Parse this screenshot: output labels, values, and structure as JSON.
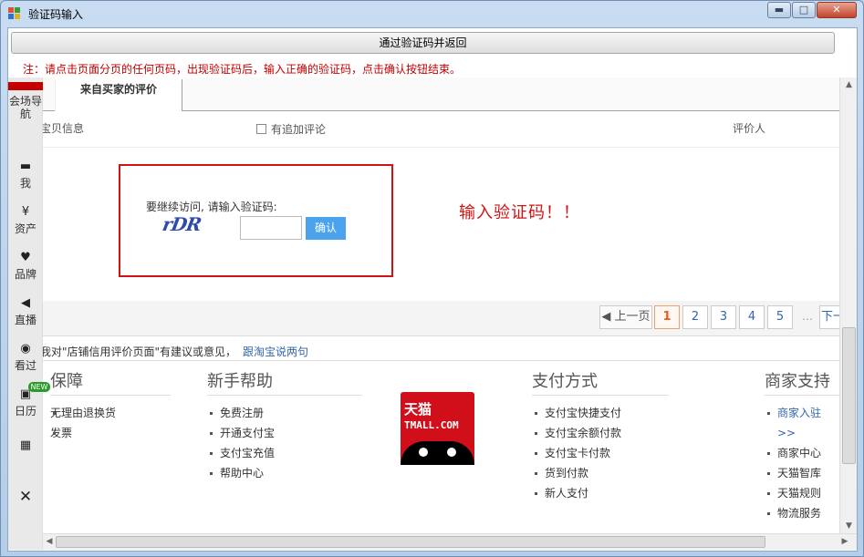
{
  "window": {
    "title": "验证码输入",
    "min_symbol": "▬",
    "max_symbol": "□",
    "close_symbol": "✕"
  },
  "toolbar": {
    "submit_label": "通过验证码并返回",
    "note": "注：请点击页面分页的任何页码，出现验证码后，输入正确的验证码，点击确认按钮结束。"
  },
  "sidebar": {
    "items": [
      {
        "label": "会场导航",
        "icon": ""
      },
      {
        "label": "我",
        "icon": "▬"
      },
      {
        "label": "资产",
        "icon": "¥"
      },
      {
        "label": "品牌",
        "icon": "♥"
      },
      {
        "label": "直播",
        "icon": "◀"
      },
      {
        "label": "看过",
        "icon": "◉"
      },
      {
        "label": "日历",
        "icon": "▣"
      },
      {
        "label": "",
        "icon": "▦"
      },
      {
        "label": "",
        "icon": "✕"
      }
    ],
    "new_badge": "NEW"
  },
  "tabs": {
    "active": "来自买家的评价"
  },
  "columns": {
    "info": "宝贝信息",
    "addon": "有追加评论",
    "reviewer": "评价人"
  },
  "captcha": {
    "prompt": "要继续访问, 请输入验证码:",
    "image_text": "rDR",
    "input_value": "",
    "confirm_label": "确认"
  },
  "warning": "输入验证码！！",
  "pager": {
    "prev": "◀ 上一页",
    "pages": [
      "1",
      "2",
      "3",
      "4",
      "5"
    ],
    "current": "1",
    "ellipsis": "…",
    "next": "下一"
  },
  "feedback": {
    "text": "我对\"店铺信用评价页面\"有建议或意见，",
    "link": "跟淘宝说两句"
  },
  "footer": {
    "col1": {
      "title": "保障",
      "items": [
        "无理由退换货",
        "发票"
      ]
    },
    "col2": {
      "title": "新手帮助",
      "items": [
        "免费注册",
        "开通支付宝",
        "支付宝充值",
        "帮助中心"
      ]
    },
    "logo_cn": "天猫",
    "logo_en": "TMALL.COM",
    "col3": {
      "title": "支付方式",
      "items": [
        "支付宝快捷支付",
        "支付宝余额付款",
        "支付宝卡付款",
        "货到付款",
        "新人支付"
      ]
    },
    "col4": {
      "title": "商家支持",
      "items": [
        "商家入驻>>",
        "商家中心",
        "天猫智库",
        "天猫规则",
        "物流服务"
      ]
    }
  },
  "colors": {
    "accent_red": "#d21313",
    "link_blue": "#3366aa",
    "button_blue": "#4aa3ec"
  }
}
